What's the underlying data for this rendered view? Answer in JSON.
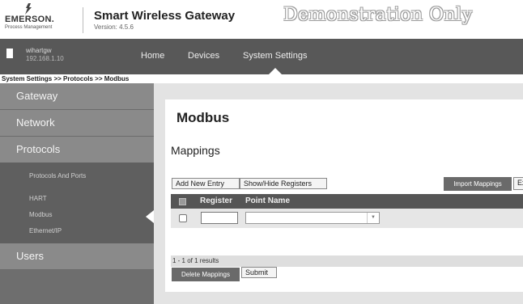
{
  "header": {
    "brand": "EMERSON.",
    "brand_tagline": "Process Management",
    "title": "Smart Wireless Gateway",
    "version": "Version: 4.5.6",
    "watermark": "Demonstration Only"
  },
  "nav": {
    "device_name": "wihartgw",
    "device_ip": "192.168.1.10",
    "items": [
      "Home",
      "Devices",
      "System Settings"
    ],
    "active": "System Settings"
  },
  "breadcrumb": "System Settings >> Protocols >> Modbus",
  "sidebar": {
    "sections": [
      "Gateway",
      "Network",
      "Protocols",
      "Users"
    ],
    "protocols_items": [
      "Protocols And Ports",
      "HART",
      "Modbus",
      "Ethernet/IP"
    ],
    "active_item": "Modbus"
  },
  "main": {
    "title": "Modbus",
    "section": "Mappings",
    "buttons": {
      "add": "Add New Entry",
      "show_hide": "Show/Hide Registers",
      "import": "Import Mappings",
      "export": "Ex",
      "delete": "Delete Mappings",
      "submit": "Submit"
    },
    "table": {
      "columns": [
        "Register",
        "Point Name"
      ],
      "rows": [
        {
          "register": "",
          "point_name": ""
        }
      ]
    },
    "results": "1 - 1 of 1 results"
  },
  "colors": {
    "navbar": "#585858",
    "sidebar_section": "#8a8a8a",
    "sidebar_sub": "#5f5f5f",
    "table_header": "#555555"
  }
}
